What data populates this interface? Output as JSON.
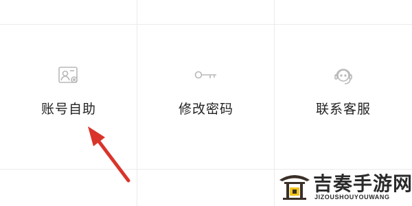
{
  "menu": {
    "items": [
      {
        "label": "账号自助",
        "icon": "id-card-gear-icon"
      },
      {
        "label": "修改密码",
        "icon": "key-icon"
      },
      {
        "label": "联系客服",
        "icon": "headset-icon"
      }
    ]
  },
  "watermark": {
    "title": "吉奏手游网",
    "subtitle": "JIZOUSHOUYOUWANG"
  },
  "colors": {
    "arrow": "#d9342b",
    "icon": "#b8b8b8",
    "divider": "#ebebeb",
    "text": "#222222"
  }
}
